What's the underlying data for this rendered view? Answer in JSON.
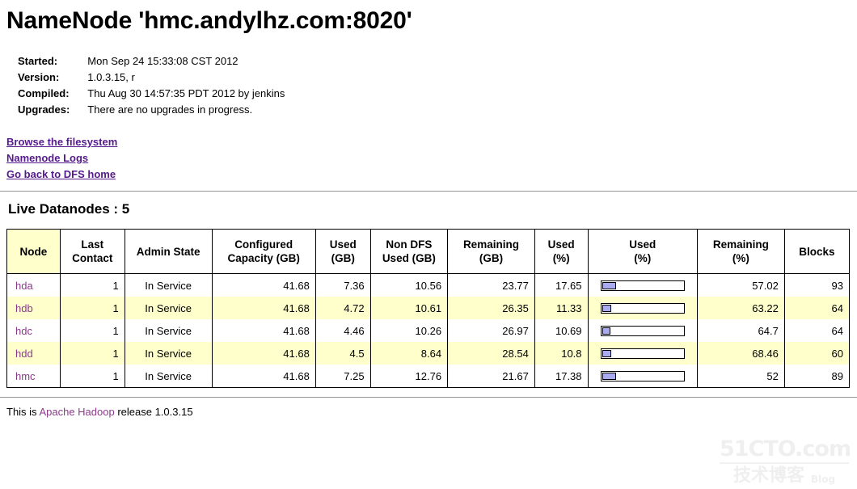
{
  "page": {
    "title": "NameNode 'hmc.andylhz.com:8020'"
  },
  "summary": {
    "rows": [
      {
        "label": "Started:",
        "value": "Mon Sep 24 15:33:08 CST 2012"
      },
      {
        "label": "Version:",
        "value": "1.0.3.15, r"
      },
      {
        "label": "Compiled:",
        "value": "Thu Aug 30 14:57:35 PDT 2012 by jenkins"
      },
      {
        "label": "Upgrades:",
        "value": "There are no upgrades in progress."
      }
    ]
  },
  "links": [
    {
      "label": "Browse the filesystem"
    },
    {
      "label": "Namenode Logs"
    },
    {
      "label": "Go back to DFS home"
    }
  ],
  "section": {
    "live_datanodes_title": "Live Datanodes : 5"
  },
  "table": {
    "headers": [
      "Node",
      "Last Contact",
      "Admin State",
      "Configured Capacity (GB)",
      "Used (GB)",
      "Non DFS Used (GB)",
      "Remaining (GB)",
      "Used (%)",
      "Used (%)",
      "Remaining (%)",
      "Blocks"
    ],
    "headers_split": [
      {
        "l1": "Node",
        "l2": ""
      },
      {
        "l1": "Last",
        "l2": "Contact"
      },
      {
        "l1": "Admin State",
        "l2": ""
      },
      {
        "l1": "Configured",
        "l2": "Capacity (GB)"
      },
      {
        "l1": "Used",
        "l2": "(GB)"
      },
      {
        "l1": "Non DFS",
        "l2": "Used (GB)"
      },
      {
        "l1": "Remaining",
        "l2": "(GB)"
      },
      {
        "l1": "Used",
        "l2": "(%)"
      },
      {
        "l1": "Used",
        "l2": "(%)"
      },
      {
        "l1": "Remaining",
        "l2": "(%)"
      },
      {
        "l1": "Blocks",
        "l2": ""
      }
    ],
    "rows": [
      {
        "node": "hda",
        "last_contact": "1",
        "admin_state": "In Service",
        "configured_capacity_gb": "41.68",
        "used_gb": "7.36",
        "non_dfs_used_gb": "10.56",
        "remaining_gb": "23.77",
        "used_pct": "17.65",
        "bar_pct": 17.65,
        "remaining_pct": "57.02",
        "blocks": "93"
      },
      {
        "node": "hdb",
        "last_contact": "1",
        "admin_state": "In Service",
        "configured_capacity_gb": "41.68",
        "used_gb": "4.72",
        "non_dfs_used_gb": "10.61",
        "remaining_gb": "26.35",
        "used_pct": "11.33",
        "bar_pct": 11.33,
        "remaining_pct": "63.22",
        "blocks": "64"
      },
      {
        "node": "hdc",
        "last_contact": "1",
        "admin_state": "In Service",
        "configured_capacity_gb": "41.68",
        "used_gb": "4.46",
        "non_dfs_used_gb": "10.26",
        "remaining_gb": "26.97",
        "used_pct": "10.69",
        "bar_pct": 10.69,
        "remaining_pct": "64.7",
        "blocks": "64"
      },
      {
        "node": "hdd",
        "last_contact": "1",
        "admin_state": "In Service",
        "configured_capacity_gb": "41.68",
        "used_gb": "4.5",
        "non_dfs_used_gb": "8.64",
        "remaining_gb": "28.54",
        "used_pct": "10.8",
        "bar_pct": 10.8,
        "remaining_pct": "68.46",
        "blocks": "60"
      },
      {
        "node": "hmc",
        "last_contact": "1",
        "admin_state": "In Service",
        "configured_capacity_gb": "41.68",
        "used_gb": "7.25",
        "non_dfs_used_gb": "12.76",
        "remaining_gb": "21.67",
        "used_pct": "17.38",
        "bar_pct": 17.38,
        "remaining_pct": "52",
        "blocks": "89"
      }
    ]
  },
  "footer": {
    "prefix": "This is ",
    "link": "Apache Hadoop",
    "suffix": " release 1.0.3.15"
  },
  "watermark": {
    "top": "51CTO.com",
    "cn": "技术博客",
    "blog": "Blog"
  },
  "colors": {
    "link": "#551a8b",
    "table_link": "#8c3a8c",
    "alt_row": "#ffffcc",
    "node_header": "#ffffcc",
    "bar_fill": "#aaaaee",
    "border": "#000000",
    "rule": "#999999"
  }
}
